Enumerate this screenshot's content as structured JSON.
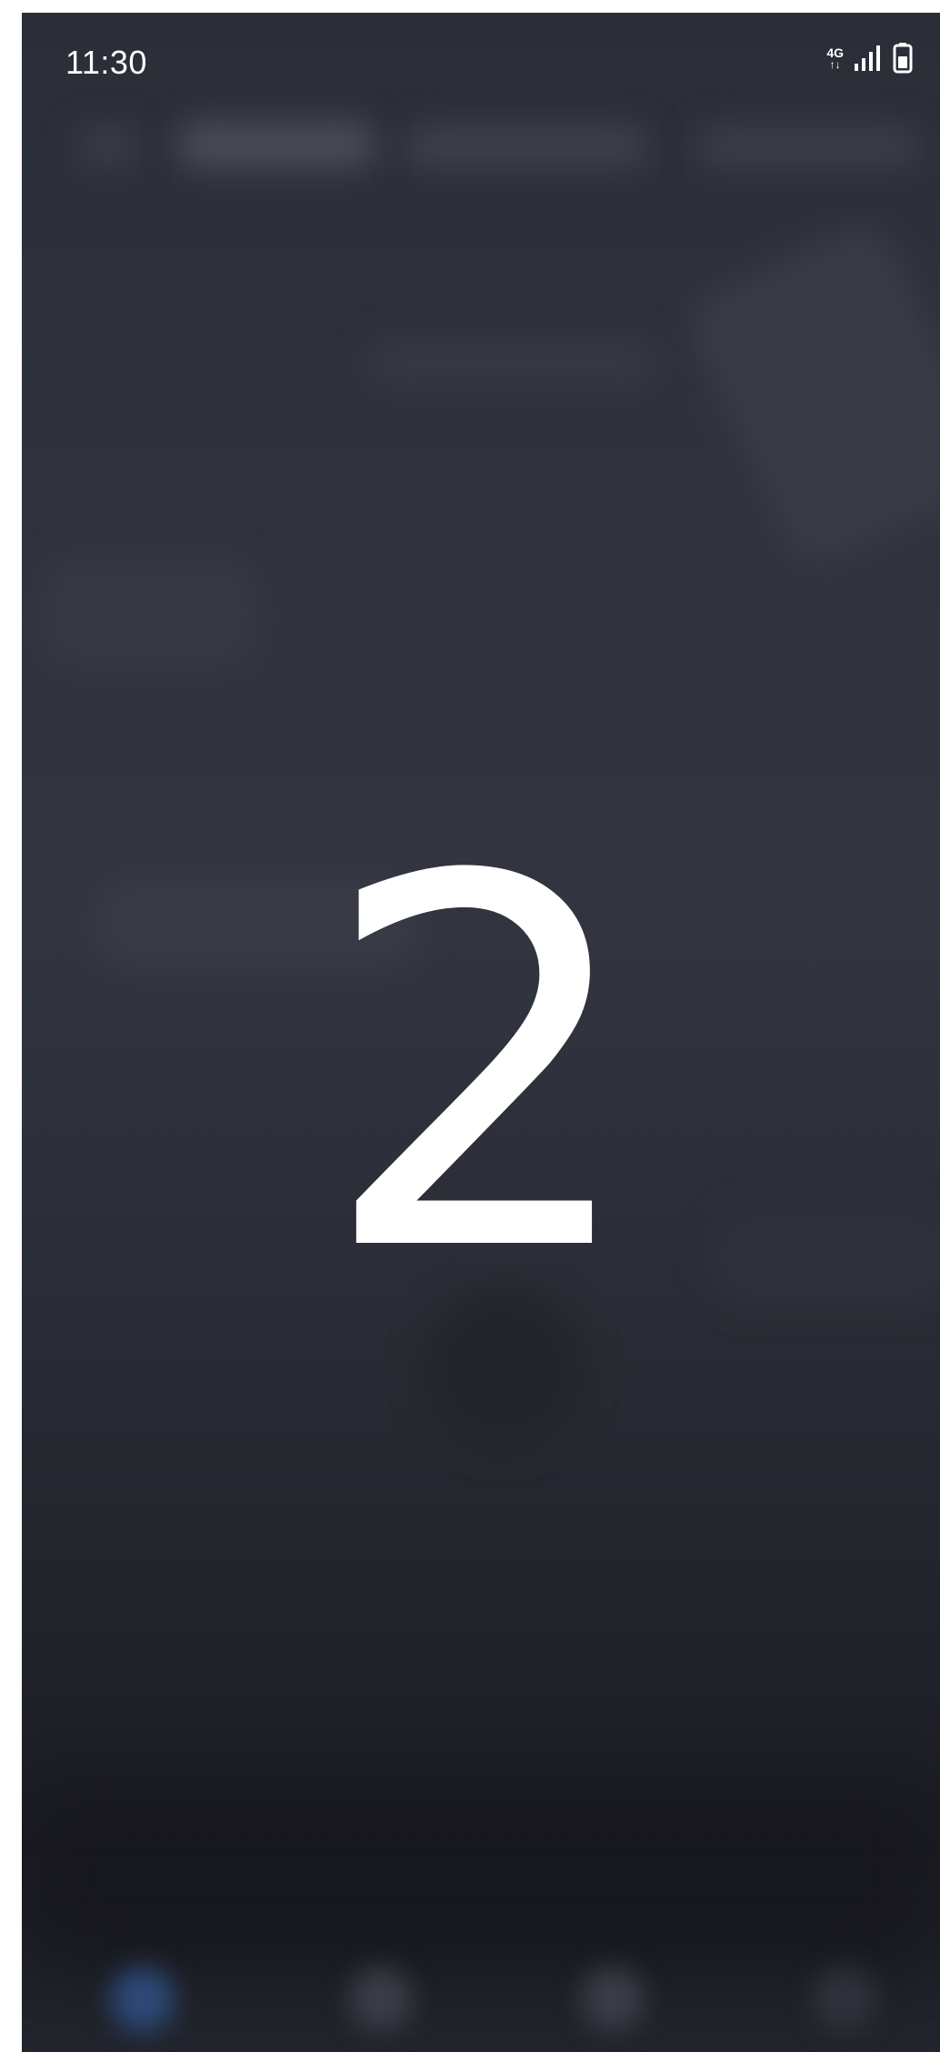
{
  "status_bar": {
    "time": "11:30",
    "network_label": "4G",
    "network_arrows": "↑↓",
    "icons": [
      "network-4g-icon",
      "signal-icon",
      "battery-icon"
    ]
  },
  "countdown": {
    "value": "2"
  },
  "colors": {
    "background_top": "#2b2e37",
    "background_bottom": "#1b1c23",
    "text": "#ffffff",
    "nav_accent": "#2d4a7a"
  }
}
